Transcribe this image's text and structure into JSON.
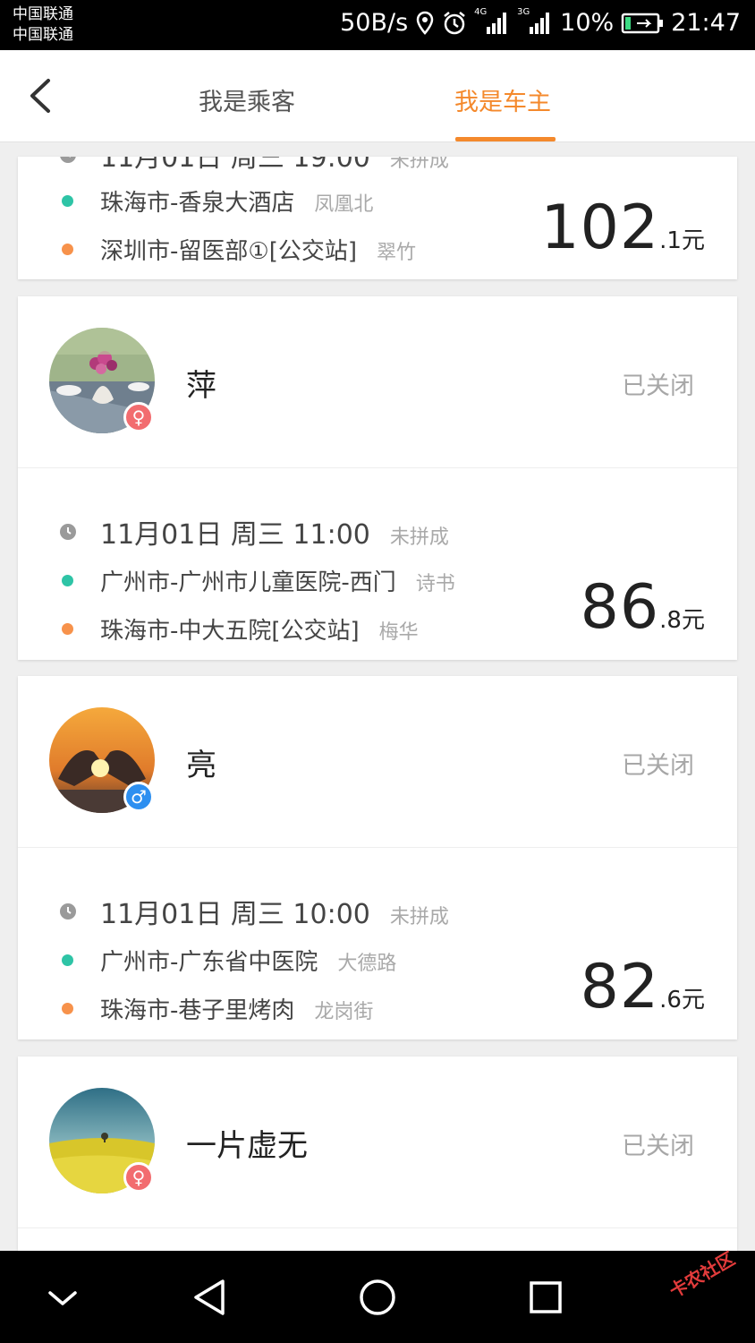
{
  "status_bar": {
    "carrier_1": "中国联通",
    "carrier_2": "中国联通",
    "speed": "50B/s",
    "net_1": "4G",
    "net_2": "3G",
    "battery": "10%",
    "time": "21:47",
    "icons": [
      "location-icon",
      "alarm-icon",
      "signal-icon",
      "battery-icon"
    ]
  },
  "nav": {
    "back_icon": "chevron-left-icon",
    "tabs": [
      {
        "label": "我是乘客",
        "active": false
      },
      {
        "label": "我是车主",
        "active": true
      }
    ]
  },
  "colors": {
    "accent": "#f4892c",
    "start_dot": "#2ec4a6",
    "end_dot": "#f7924b",
    "female_badge": "#f26c6f",
    "male_badge": "#2d8ff0"
  },
  "partial_trip": {
    "datetime": "11月01日 周三 19:00",
    "status": "未拼成",
    "from": "珠海市-香泉大酒店",
    "from_area": "凤凰北",
    "to": "深圳市-留医部①[公交站]",
    "to_area": "翠竹",
    "price_int": "102",
    "price_dec": ".1",
    "unit": "元"
  },
  "orders": [
    {
      "name": "萍",
      "gender": "female",
      "gender_symbol": "♀",
      "state": "已关闭",
      "datetime": "11月01日 周三 11:00",
      "status": "未拼成",
      "from": "广州市-广州市儿童医院-西门",
      "from_area": "诗书",
      "to": "珠海市-中大五院[公交站]",
      "to_area": "梅华",
      "price_int": "86",
      "price_dec": ".8",
      "unit": "元"
    },
    {
      "name": "亮",
      "gender": "male",
      "gender_symbol": "♂",
      "state": "已关闭",
      "datetime": "11月01日 周三 10:00",
      "status": "未拼成",
      "from": "广州市-广东省中医院",
      "from_area": "大德路",
      "to": "珠海市-巷子里烤肉",
      "to_area": "龙岗街",
      "price_int": "82",
      "price_dec": ".6",
      "unit": "元"
    },
    {
      "name": "一片虚无",
      "gender": "female",
      "gender_symbol": "♀",
      "state": "已关闭"
    }
  ],
  "bottom_nav": {
    "icons": [
      "chevron-down-icon",
      "back-triangle-icon",
      "home-circle-icon",
      "recent-square-icon"
    ]
  },
  "watermark": "卡农社区"
}
